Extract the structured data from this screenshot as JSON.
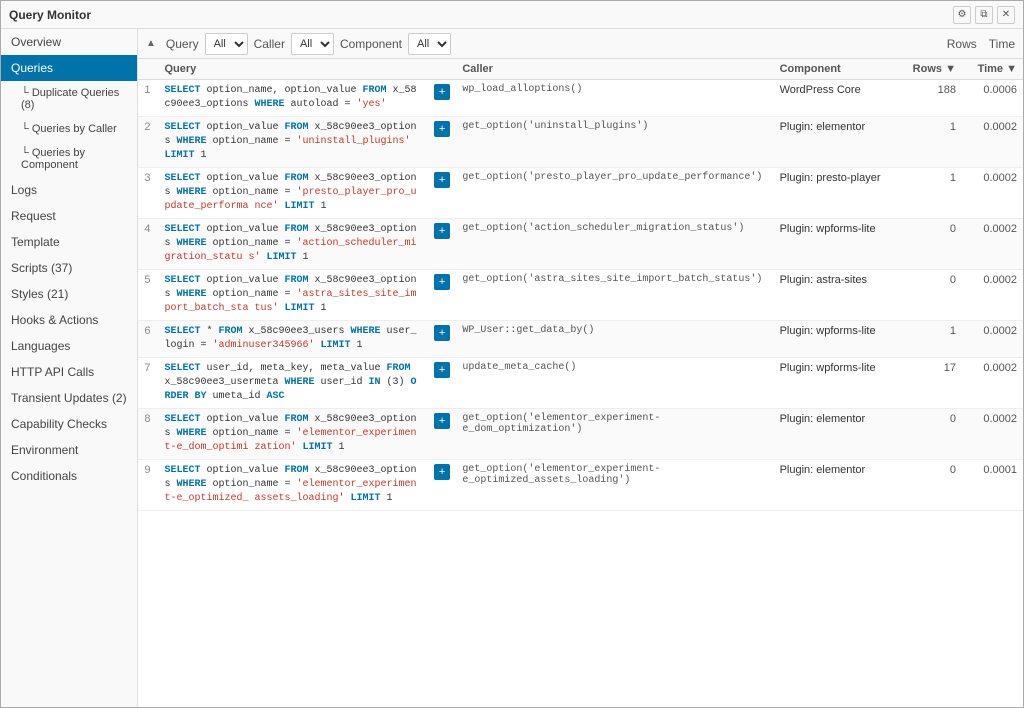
{
  "titleBar": {
    "title": "Query Monitor",
    "controls": [
      "settings-icon",
      "detach-icon",
      "close-icon"
    ]
  },
  "sidebar": {
    "items": [
      {
        "id": "overview",
        "label": "Overview",
        "active": false,
        "sub": false
      },
      {
        "id": "queries",
        "label": "Queries",
        "active": true,
        "sub": false
      },
      {
        "id": "duplicate-queries",
        "label": "└ Duplicate Queries (8)",
        "active": false,
        "sub": true
      },
      {
        "id": "queries-by-caller",
        "label": "└ Queries by Caller",
        "active": false,
        "sub": true
      },
      {
        "id": "queries-by-component",
        "label": "└ Queries by Component",
        "active": false,
        "sub": true
      },
      {
        "id": "logs",
        "label": "Logs",
        "active": false,
        "sub": false
      },
      {
        "id": "request",
        "label": "Request",
        "active": false,
        "sub": false
      },
      {
        "id": "template",
        "label": "Template",
        "active": false,
        "sub": false
      },
      {
        "id": "scripts",
        "label": "Scripts (37)",
        "active": false,
        "sub": false
      },
      {
        "id": "styles",
        "label": "Styles (21)",
        "active": false,
        "sub": false
      },
      {
        "id": "hooks-actions",
        "label": "Hooks & Actions",
        "active": false,
        "sub": false
      },
      {
        "id": "languages",
        "label": "Languages",
        "active": false,
        "sub": false
      },
      {
        "id": "http-api-calls",
        "label": "HTTP API Calls",
        "active": false,
        "sub": false
      },
      {
        "id": "transient-updates",
        "label": "Transient Updates (2)",
        "active": false,
        "sub": false
      },
      {
        "id": "capability-checks",
        "label": "Capability Checks",
        "active": false,
        "sub": false
      },
      {
        "id": "environment",
        "label": "Environment",
        "active": false,
        "sub": false
      },
      {
        "id": "conditionals",
        "label": "Conditionals",
        "active": false,
        "sub": false
      }
    ]
  },
  "toolbar": {
    "sortLabel": "▲",
    "queryLabel": "Query",
    "callerLabel": "Caller",
    "componentLabel": "Component",
    "rowsLabel": "Rows",
    "timeLabel": "Time",
    "queryFilterOptions": [
      "All"
    ],
    "callerFilterOptions": [
      "All"
    ],
    "componentFilterOptions": [
      "All"
    ],
    "queryFilterValue": "All",
    "callerFilterValue": "All",
    "componentFilterValue": "All"
  },
  "queries": [
    {
      "num": 1,
      "query": "SELECT option_name, option_value\nFROM x_58c90ee3_options\nWHERE autoload = 'yes'",
      "caller": "wp_load_alloptions()",
      "component": "WordPress Core",
      "rows": 188,
      "time": "0.0006"
    },
    {
      "num": 2,
      "query": "SELECT option_value\nFROM x_58c90ee3_options\nWHERE option_name = 'uninstall_plugins'\nLIMIT 1",
      "caller": "get_option('uninstall_plugins')",
      "component": "Plugin: elementor",
      "rows": 1,
      "time": "0.0002"
    },
    {
      "num": 3,
      "query": "SELECT option_value\nFROM x_58c90ee3_options\nWHERE option_name = 'presto_player_pro_update_performa\nnce'\nLIMIT 1",
      "caller": "get_option('presto_player_pro_update_performance')",
      "component": "Plugin: presto-player",
      "rows": 1,
      "time": "0.0002"
    },
    {
      "num": 4,
      "query": "SELECT option_value\nFROM x_58c90ee3_options\nWHERE option_name = 'action_scheduler_migration_statu\ns'\nLIMIT 1",
      "caller": "get_option('action_scheduler_migration_status')",
      "component": "Plugin: wpforms-lite",
      "rows": 0,
      "time": "0.0002"
    },
    {
      "num": 5,
      "query": "SELECT option_value\nFROM x_58c90ee3_options\nWHERE option_name = 'astra_sites_site_import_batch_sta\ntus'\nLIMIT 1",
      "caller": "get_option('astra_sites_site_import_batch_status')",
      "component": "Plugin: astra-sites",
      "rows": 0,
      "time": "0.0002"
    },
    {
      "num": 6,
      "query": "SELECT *\nFROM x_58c90ee3_users\nWHERE user_login = 'adminuser345966'\nLIMIT 1",
      "caller": "WP_User::get_data_by()",
      "component": "Plugin: wpforms-lite",
      "rows": 1,
      "time": "0.0002"
    },
    {
      "num": 7,
      "query": "SELECT user_id, meta_key, meta_value\nFROM x_58c90ee3_usermeta\nWHERE user_id IN (3)\nORDER BY umeta_id ASC",
      "caller": "update_meta_cache()",
      "component": "Plugin: wpforms-lite",
      "rows": 17,
      "time": "0.0002"
    },
    {
      "num": 8,
      "query": "SELECT option_value\nFROM x_58c90ee3_options\nWHERE option_name = 'elementor_experiment-e_dom_optimi\nzation'\nLIMIT 1",
      "caller": "get_option('elementor_experiment-e_dom_optimization')",
      "component": "Plugin: elementor",
      "rows": 0,
      "time": "0.0002"
    },
    {
      "num": 9,
      "query": "SELECT option_value\nFROM x_58c90ee3_options\nWHERE option_name = 'elementor_experiment-e_optimized_\nassets_loading'\nLIMIT 1",
      "caller": "get_option('elementor_experiment-e_optimized_assets_loading')",
      "component": "Plugin: elementor",
      "rows": 0,
      "time": "0.0001"
    }
  ]
}
